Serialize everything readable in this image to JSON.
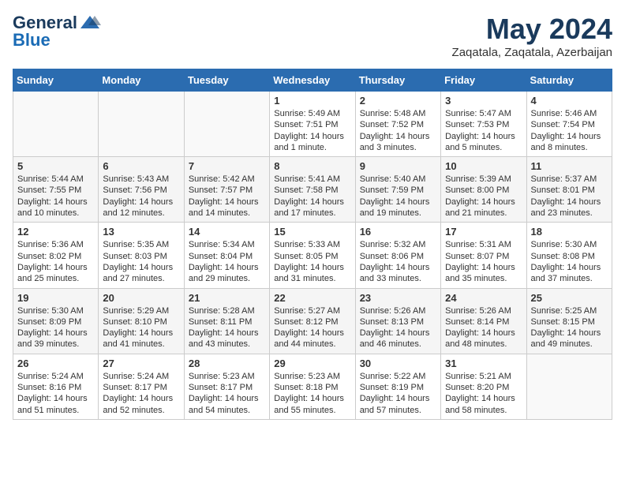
{
  "header": {
    "logo_general": "General",
    "logo_blue": "Blue",
    "month": "May 2024",
    "location": "Zaqatala, Zaqatala, Azerbaijan"
  },
  "weekdays": [
    "Sunday",
    "Monday",
    "Tuesday",
    "Wednesday",
    "Thursday",
    "Friday",
    "Saturday"
  ],
  "weeks": [
    [
      {
        "day": "",
        "info": ""
      },
      {
        "day": "",
        "info": ""
      },
      {
        "day": "",
        "info": ""
      },
      {
        "day": "1",
        "info": "Sunrise: 5:49 AM\nSunset: 7:51 PM\nDaylight: 14 hours and 1 minute."
      },
      {
        "day": "2",
        "info": "Sunrise: 5:48 AM\nSunset: 7:52 PM\nDaylight: 14 hours and 3 minutes."
      },
      {
        "day": "3",
        "info": "Sunrise: 5:47 AM\nSunset: 7:53 PM\nDaylight: 14 hours and 5 minutes."
      },
      {
        "day": "4",
        "info": "Sunrise: 5:46 AM\nSunset: 7:54 PM\nDaylight: 14 hours and 8 minutes."
      }
    ],
    [
      {
        "day": "5",
        "info": "Sunrise: 5:44 AM\nSunset: 7:55 PM\nDaylight: 14 hours and 10 minutes."
      },
      {
        "day": "6",
        "info": "Sunrise: 5:43 AM\nSunset: 7:56 PM\nDaylight: 14 hours and 12 minutes."
      },
      {
        "day": "7",
        "info": "Sunrise: 5:42 AM\nSunset: 7:57 PM\nDaylight: 14 hours and 14 minutes."
      },
      {
        "day": "8",
        "info": "Sunrise: 5:41 AM\nSunset: 7:58 PM\nDaylight: 14 hours and 17 minutes."
      },
      {
        "day": "9",
        "info": "Sunrise: 5:40 AM\nSunset: 7:59 PM\nDaylight: 14 hours and 19 minutes."
      },
      {
        "day": "10",
        "info": "Sunrise: 5:39 AM\nSunset: 8:00 PM\nDaylight: 14 hours and 21 minutes."
      },
      {
        "day": "11",
        "info": "Sunrise: 5:37 AM\nSunset: 8:01 PM\nDaylight: 14 hours and 23 minutes."
      }
    ],
    [
      {
        "day": "12",
        "info": "Sunrise: 5:36 AM\nSunset: 8:02 PM\nDaylight: 14 hours and 25 minutes."
      },
      {
        "day": "13",
        "info": "Sunrise: 5:35 AM\nSunset: 8:03 PM\nDaylight: 14 hours and 27 minutes."
      },
      {
        "day": "14",
        "info": "Sunrise: 5:34 AM\nSunset: 8:04 PM\nDaylight: 14 hours and 29 minutes."
      },
      {
        "day": "15",
        "info": "Sunrise: 5:33 AM\nSunset: 8:05 PM\nDaylight: 14 hours and 31 minutes."
      },
      {
        "day": "16",
        "info": "Sunrise: 5:32 AM\nSunset: 8:06 PM\nDaylight: 14 hours and 33 minutes."
      },
      {
        "day": "17",
        "info": "Sunrise: 5:31 AM\nSunset: 8:07 PM\nDaylight: 14 hours and 35 minutes."
      },
      {
        "day": "18",
        "info": "Sunrise: 5:30 AM\nSunset: 8:08 PM\nDaylight: 14 hours and 37 minutes."
      }
    ],
    [
      {
        "day": "19",
        "info": "Sunrise: 5:30 AM\nSunset: 8:09 PM\nDaylight: 14 hours and 39 minutes."
      },
      {
        "day": "20",
        "info": "Sunrise: 5:29 AM\nSunset: 8:10 PM\nDaylight: 14 hours and 41 minutes."
      },
      {
        "day": "21",
        "info": "Sunrise: 5:28 AM\nSunset: 8:11 PM\nDaylight: 14 hours and 43 minutes."
      },
      {
        "day": "22",
        "info": "Sunrise: 5:27 AM\nSunset: 8:12 PM\nDaylight: 14 hours and 44 minutes."
      },
      {
        "day": "23",
        "info": "Sunrise: 5:26 AM\nSunset: 8:13 PM\nDaylight: 14 hours and 46 minutes."
      },
      {
        "day": "24",
        "info": "Sunrise: 5:26 AM\nSunset: 8:14 PM\nDaylight: 14 hours and 48 minutes."
      },
      {
        "day": "25",
        "info": "Sunrise: 5:25 AM\nSunset: 8:15 PM\nDaylight: 14 hours and 49 minutes."
      }
    ],
    [
      {
        "day": "26",
        "info": "Sunrise: 5:24 AM\nSunset: 8:16 PM\nDaylight: 14 hours and 51 minutes."
      },
      {
        "day": "27",
        "info": "Sunrise: 5:24 AM\nSunset: 8:17 PM\nDaylight: 14 hours and 52 minutes."
      },
      {
        "day": "28",
        "info": "Sunrise: 5:23 AM\nSunset: 8:17 PM\nDaylight: 14 hours and 54 minutes."
      },
      {
        "day": "29",
        "info": "Sunrise: 5:23 AM\nSunset: 8:18 PM\nDaylight: 14 hours and 55 minutes."
      },
      {
        "day": "30",
        "info": "Sunrise: 5:22 AM\nSunset: 8:19 PM\nDaylight: 14 hours and 57 minutes."
      },
      {
        "day": "31",
        "info": "Sunrise: 5:21 AM\nSunset: 8:20 PM\nDaylight: 14 hours and 58 minutes."
      },
      {
        "day": "",
        "info": ""
      }
    ]
  ]
}
